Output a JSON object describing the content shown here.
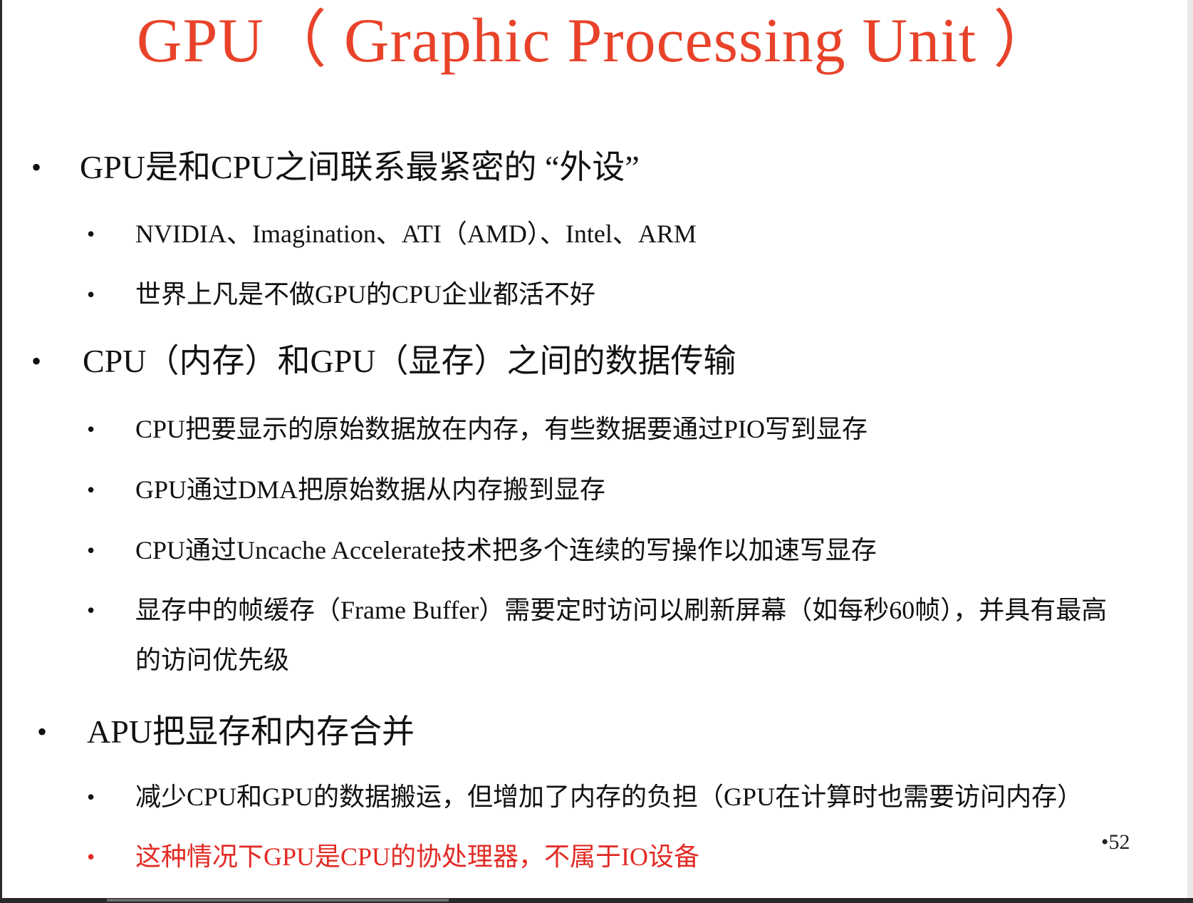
{
  "slide": {
    "title": "GPU（ Graphic Processing Unit ）",
    "page_number": "•52",
    "bullet_symbol": "•",
    "colors": {
      "title": "#e8432a",
      "highlight": "#e22a24",
      "text": "#111111"
    },
    "sections": [
      {
        "heading": "GPU是和CPU之间联系最紧密的 “外设”",
        "items": [
          "NVIDIA、Imagination、ATI（AMD）、Intel、ARM",
          "世界上凡是不做GPU的CPU企业都活不好"
        ]
      },
      {
        "heading": "CPU（内存）和GPU（显存）之间的数据传输",
        "items": [
          "CPU把要显示的原始数据放在内存，有些数据要通过PIO写到显存",
          "GPU通过DMA把原始数据从内存搬到显存",
          "CPU通过Uncache Accelerate技术把多个连续的写操作以加速写显存",
          "显存中的帧缓存（Frame Buffer）需要定时访问以刷新屏幕（如每秒60帧），并具有最高",
          "的访问优先级"
        ]
      },
      {
        "heading": "APU把显存和内存合并",
        "items": [
          "减少CPU和GPU的数据搬运，但增加了内存的负担（GPU在计算时也需要访问内存）",
          "这种情况下GPU是CPU的协处理器，不属于IO设备"
        ]
      }
    ]
  }
}
